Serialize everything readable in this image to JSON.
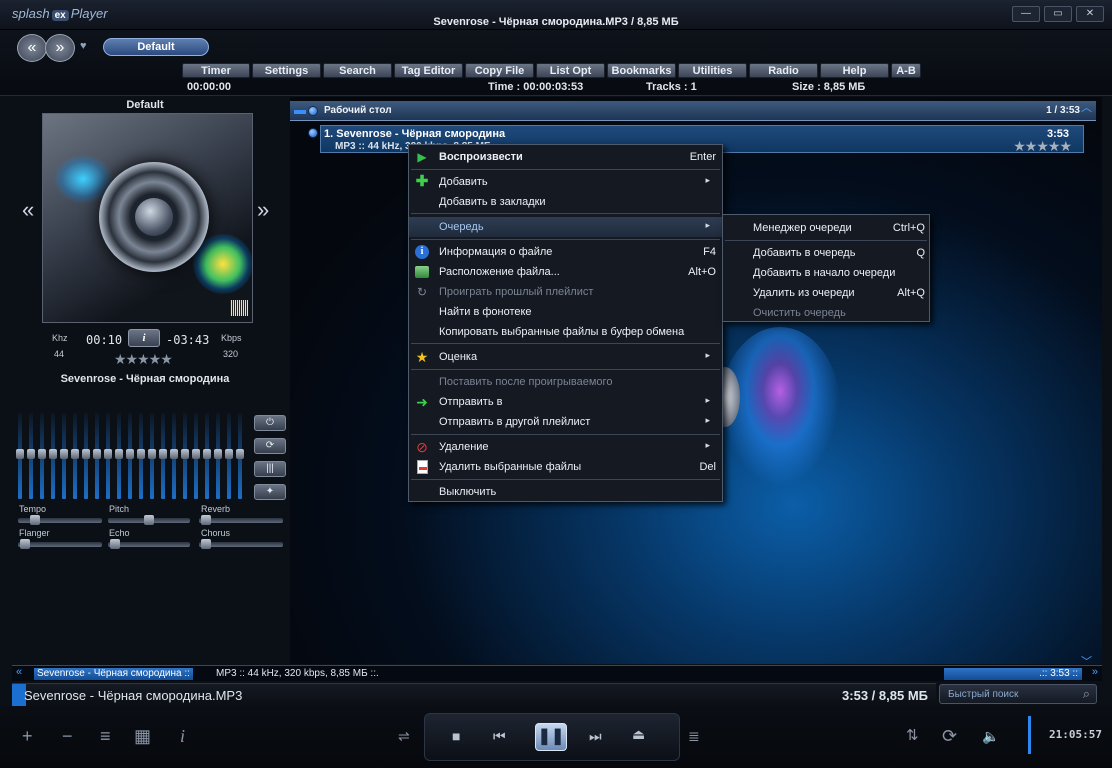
{
  "window": {
    "logo": "splash",
    "logo_badge": "ex",
    "logo_player": "Player",
    "title": "Sevenrose - Чёрная смородина.MP3 / 8,85 МБ",
    "buttons": [
      "min",
      "max",
      "close"
    ]
  },
  "top": {
    "nav_back_icon": "back-arrow-icon",
    "nav_fwd_icon": "forward-arrow-icon",
    "preset": "Default",
    "menus": [
      "Timer",
      "Settings",
      "Search",
      "Tag Editor",
      "Copy File",
      "List Opt",
      "Bookmarks",
      "Utilities",
      "Radio",
      "Help",
      "A-B"
    ],
    "timer_value": "00:00:00",
    "time_info": "Time : 00:00:03:53",
    "tracks_info": "Tracks : 1",
    "size_info": "Size : 8,85 МБ"
  },
  "left": {
    "preset_title": "Default",
    "khz_label": "Khz",
    "khz_value": "44",
    "kbps_label": "Kbps",
    "kbps_value": "320",
    "elapsed": "00:10",
    "remaining": "-03:43",
    "info_btn": "i",
    "rating_stars": "★★★★★",
    "song": "Sevenrose - Чёрная смородина",
    "prev_icon": "«",
    "next_icon": "»",
    "eq_buttons": [
      "⏻",
      "⟳",
      "|||",
      "✦"
    ],
    "fx": [
      "Tempo",
      "Pitch",
      "Reverb",
      "Flanger",
      "Echo",
      "Chorus"
    ]
  },
  "playlist": {
    "header_title": "Рабочий стол",
    "header_count": "1 / 3:53",
    "track": {
      "title": "1. Sevenrose - Чёрная смородина",
      "subtitle": "MP3 :: 44 kHz, 320 kbps, 8,85 МБ",
      "duration": "3:53",
      "stars": "★★★★★"
    }
  },
  "context_menu": {
    "items": [
      {
        "label": "Воспроизвести",
        "shortcut": "Enter",
        "icon": "play-icon"
      },
      {
        "label": "Добавить",
        "submenu": true,
        "icon": "plus-icon"
      },
      {
        "label": "Добавить в закладки"
      },
      {
        "label": "Очередь",
        "submenu": true
      },
      {
        "label": "Информация о файле",
        "shortcut": "F4",
        "icon": "info-icon"
      },
      {
        "label": "Расположение файла...",
        "shortcut": "Alt+O",
        "icon": "folder-icon"
      },
      {
        "label": "Проиграть прошлый плейлист",
        "icon": "reload-icon"
      },
      {
        "label": "Найти в фонотеке"
      },
      {
        "label": "Копировать выбранные файлы в буфер обмена"
      },
      {
        "label": "Оценка",
        "submenu": true,
        "icon": "star-icon"
      },
      {
        "label": "Поставить после проигрываемого"
      },
      {
        "label": "Отправить в",
        "submenu": true,
        "icon": "arrow-right-icon"
      },
      {
        "label": "Отправить в другой плейлист",
        "submenu": true
      },
      {
        "label": "Удаление",
        "submenu": true,
        "icon": "no-entry-icon"
      },
      {
        "label": "Удалить выбранные файлы",
        "shortcut": "Del",
        "icon": "delete-file-icon"
      },
      {
        "label": "Выключить"
      }
    ],
    "arrow": "▸"
  },
  "queue_submenu": {
    "items": [
      {
        "label": "Менеджер очереди",
        "shortcut": "Ctrl+Q"
      },
      {
        "label": "Добавить в очередь",
        "shortcut": "Q"
      },
      {
        "label": "Добавить в начало очереди",
        "shortcut": ""
      },
      {
        "label": "Удалить из очереди",
        "shortcut": "Alt+Q"
      },
      {
        "label": "Очистить очередь",
        "shortcut": ""
      }
    ]
  },
  "status": {
    "scroll_song": "Sevenrose - Чёрная смородина ::",
    "scroll_info": "MP3 :: 44 kHz, 320 kbps, 8,85 МБ ::.",
    "scroll_right": ".:: 3:53 ::",
    "now_playing": "Sevenrose - Чёрная смородина.MP3",
    "now_right": "3:53 / 8,85 МБ",
    "search_placeholder": "Быстрый поиск"
  },
  "controls": {
    "clock": "21:05:57",
    "left_icons": [
      "+",
      "−",
      "≡",
      "▦",
      "i"
    ],
    "right_icons": [
      "⇅",
      "⟳",
      "🔈"
    ]
  }
}
